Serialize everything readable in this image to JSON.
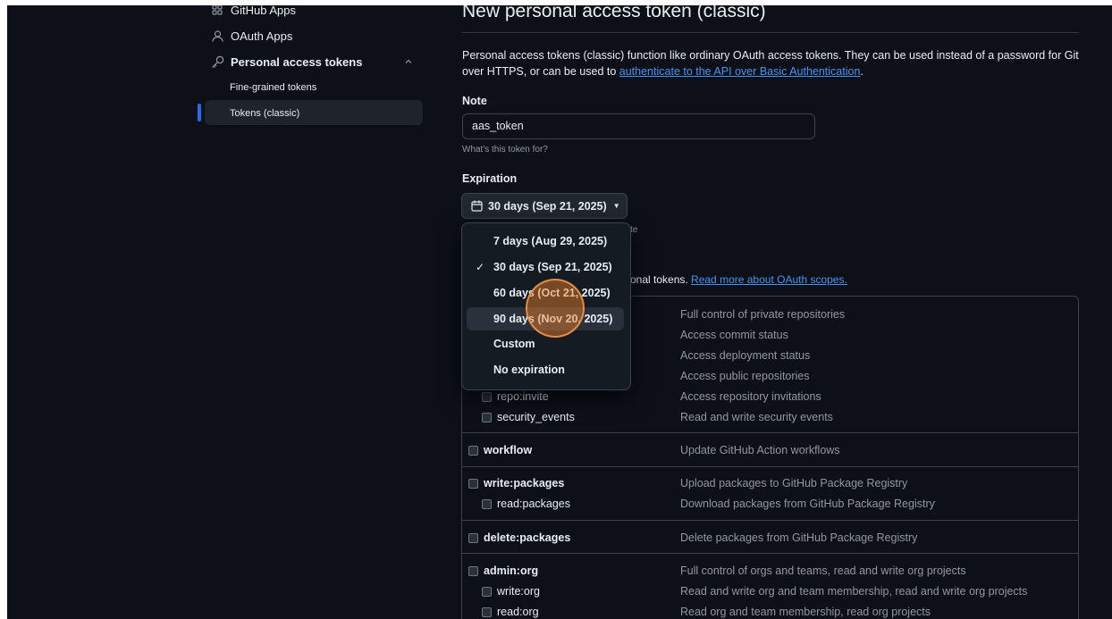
{
  "sidebar": {
    "github_apps": "GitHub Apps",
    "oauth_apps": "OAuth Apps",
    "personal_access_tokens": "Personal access tokens",
    "fine_grained": "Fine-grained tokens",
    "tokens_classic": "Tokens (classic)"
  },
  "page": {
    "title": "New personal access token (classic)",
    "description": "Personal access tokens (classic) function like ordinary OAuth access tokens. They can be used instead of a password for Git over HTTPS, or can be used to ",
    "description_link": "authenticate to the API over Basic Authentication",
    "description_end": "."
  },
  "note": {
    "label": "Note",
    "value": "aas_token",
    "hint": "What's this token for?"
  },
  "expiration": {
    "label": "Expiration",
    "selected": "30 days (Sep 21, 2025)",
    "hidden_text_fragment": "te",
    "options": [
      {
        "label": "7 days (Aug 29, 2025)",
        "checked": false
      },
      {
        "label": "30 days (Sep 21, 2025)",
        "checked": true
      },
      {
        "label": "60 days (Oct 21, 2025)",
        "checked": false
      },
      {
        "label": "90 days (Nov 20, 2025)",
        "checked": false
      },
      {
        "label": "Custom",
        "checked": false
      },
      {
        "label": "No expiration",
        "checked": false
      }
    ],
    "check_glyph": "✓"
  },
  "scopes_intro": {
    "partial_text": "onal tokens. ",
    "link": "Read more about OAuth scopes."
  },
  "scopes": {
    "repo_status_desc": "Full control of private repositories",
    "repo_status2_desc": "Access commit status",
    "repo_deployment_desc": "Access deployment status",
    "public_repo_desc": "Access public repositories",
    "repo_invite": "repo:invite",
    "repo_invite_desc": "Access repository invitations",
    "security_events": "security_events",
    "security_events_desc": "Read and write security events",
    "workflow": "workflow",
    "workflow_desc": "Update GitHub Action workflows",
    "write_packages": "write:packages",
    "write_packages_desc": "Upload packages to GitHub Package Registry",
    "read_packages": "read:packages",
    "read_packages_desc": "Download packages from GitHub Package Registry",
    "delete_packages": "delete:packages",
    "delete_packages_desc": "Delete packages from GitHub Package Registry",
    "admin_org": "admin:org",
    "admin_org_desc": "Full control of orgs and teams, read and write org projects",
    "write_org": "write:org",
    "write_org_desc": "Read and write org and team membership, read and write org projects",
    "read_org": "read:org",
    "read_org_desc": "Read org and team membership, read org projects"
  },
  "colors": {
    "background": "#0d1117",
    "link": "#4493f8",
    "accent": "#1f6feb",
    "cursor": "#f08228"
  }
}
